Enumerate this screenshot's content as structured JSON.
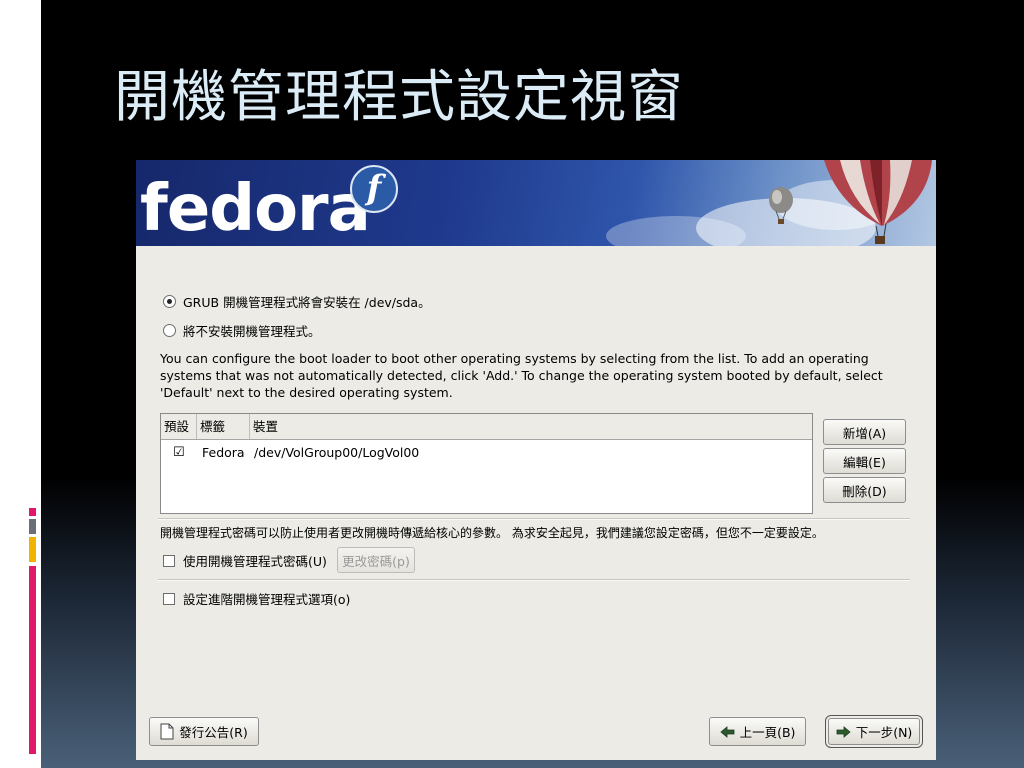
{
  "slide": {
    "title": "開機管理程式設定視窗",
    "colors": {
      "background": "#000000",
      "title": "#dcecf7",
      "accent_pink": "#e0186a",
      "accent_yellow": "#f0b400",
      "accent_gray": "#6a6e78"
    }
  },
  "installer": {
    "banner": {
      "logo_text": "fedora",
      "logo_badge": "f"
    },
    "bootloader_options": {
      "install_grub": {
        "label": "GRUB 開機管理程式將會安裝在 /dev/sda。",
        "selected": true
      },
      "no_bootloader": {
        "label": "將不安裝開機管理程式。",
        "selected": false
      }
    },
    "description": "You can configure the boot loader to boot other operating systems by selecting from the list. To add an operating systems that was not automatically detected, click 'Add.' To change the operating system booted by default, select 'Default' next to the desired operating system.",
    "os_list": {
      "columns": [
        "預設",
        "標籤",
        "裝置"
      ],
      "rows": [
        {
          "default_checked": "☑",
          "label": "Fedora",
          "device": "/dev/VolGroup00/LogVol00"
        }
      ]
    },
    "list_buttons": {
      "add": "新增(A)",
      "edit": "編輯(E)",
      "delete": "刪除(D)"
    },
    "password": {
      "note": "開機管理程式密碼可以防止使用者更改開機時傳遞給核心的參數。 為求安全起見，我們建議您設定密碼，但您不一定要設定。",
      "use_password_label": "使用開機管理程式密碼(U)",
      "use_password_checked": false,
      "change_password_button": "更改密碼(p)"
    },
    "advanced": {
      "label": "設定進階開機管理程式選項(o)",
      "checked": false
    },
    "footer": {
      "release_notes": "發行公告(R)",
      "back": "上一頁(B)",
      "next": "下一步(N)"
    }
  }
}
